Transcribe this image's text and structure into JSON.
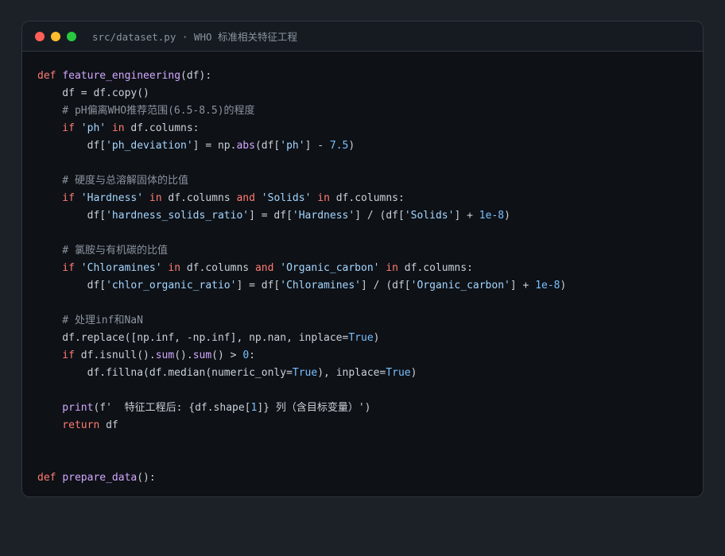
{
  "window": {
    "title": "src/dataset.py · WHO 标准相关特征工程",
    "controls": {
      "close_color": "#ff5f57",
      "minimize_color": "#febc2e",
      "maximize_color": "#28c840"
    }
  },
  "theme": {
    "background": "#0e1116",
    "keyword": "#ff7b72",
    "function": "#d2a8ff",
    "string": "#a5d6ff",
    "number": "#79c0ff",
    "comment": "#8b949e",
    "text": "#c9d1d9"
  },
  "code_lines": [
    [
      [
        "kw",
        "def"
      ],
      [
        "id",
        " "
      ],
      [
        "fn",
        "feature_engineering"
      ],
      [
        "id",
        "(df):"
      ]
    ],
    [
      [
        "id",
        "    df = df.copy()"
      ]
    ],
    [
      [
        "cm",
        "    # pH偏离WHO推荐范围(6.5-8.5)的程度"
      ]
    ],
    [
      [
        "kw",
        "    if "
      ],
      [
        "str",
        "'ph'"
      ],
      [
        "kw",
        " in"
      ],
      [
        "id",
        " df.columns:"
      ]
    ],
    [
      [
        "id",
        "        df["
      ],
      [
        "str",
        "'ph_deviation'"
      ],
      [
        "id",
        "] = np."
      ],
      [
        "fn",
        "abs"
      ],
      [
        "id",
        "(df["
      ],
      [
        "str",
        "'ph'"
      ],
      [
        "id",
        "] - "
      ],
      [
        "num",
        "7.5"
      ],
      [
        "id",
        ")"
      ]
    ],
    [],
    [
      [
        "cm",
        "    # 硬度与总溶解固体的比值"
      ]
    ],
    [
      [
        "kw",
        "    if "
      ],
      [
        "str",
        "'Hardness'"
      ],
      [
        "kw",
        " in"
      ],
      [
        "id",
        " df.columns "
      ],
      [
        "kw",
        "and"
      ],
      [
        "id",
        " "
      ],
      [
        "str",
        "'Solids'"
      ],
      [
        "kw",
        " in"
      ],
      [
        "id",
        " df.columns:"
      ]
    ],
    [
      [
        "id",
        "        df["
      ],
      [
        "str",
        "'hardness_solids_ratio'"
      ],
      [
        "id",
        "] = df["
      ],
      [
        "str",
        "'Hardness'"
      ],
      [
        "id",
        "] / (df["
      ],
      [
        "str",
        "'Solids'"
      ],
      [
        "id",
        "] + "
      ],
      [
        "num",
        "1e-8"
      ],
      [
        "id",
        ")"
      ]
    ],
    [],
    [
      [
        "cm",
        "    # 氯胺与有机碳的比值"
      ]
    ],
    [
      [
        "kw",
        "    if "
      ],
      [
        "str",
        "'Chloramines'"
      ],
      [
        "kw",
        " in"
      ],
      [
        "id",
        " df.columns "
      ],
      [
        "kw",
        "and"
      ],
      [
        "id",
        " "
      ],
      [
        "str",
        "'Organic_carbon'"
      ],
      [
        "kw",
        " in"
      ],
      [
        "id",
        " df.columns:"
      ]
    ],
    [
      [
        "id",
        "        df["
      ],
      [
        "str",
        "'chlor_organic_ratio'"
      ],
      [
        "id",
        "] = df["
      ],
      [
        "str",
        "'Chloramines'"
      ],
      [
        "id",
        "] / (df["
      ],
      [
        "str",
        "'Organic_carbon'"
      ],
      [
        "id",
        "] + "
      ],
      [
        "num",
        "1e-8"
      ],
      [
        "id",
        ")"
      ]
    ],
    [],
    [
      [
        "cm",
        "    # 处理inf和NaN"
      ]
    ],
    [
      [
        "id",
        "    df.replace([np.inf, -np.inf], np.nan, inplace="
      ],
      [
        "bool",
        "True"
      ],
      [
        "id",
        ")"
      ]
    ],
    [
      [
        "kw",
        "    if"
      ],
      [
        "id",
        " df.isnull()."
      ],
      [
        "fn",
        "sum"
      ],
      [
        "id",
        "()."
      ],
      [
        "fn",
        "sum"
      ],
      [
        "id",
        "() > "
      ],
      [
        "num",
        "0"
      ],
      [
        "id",
        ":"
      ]
    ],
    [
      [
        "id",
        "        df.fillna(df.median(numeric_only="
      ],
      [
        "bool",
        "True"
      ],
      [
        "id",
        "), inplace="
      ],
      [
        "bool",
        "True"
      ],
      [
        "id",
        ")"
      ]
    ],
    [],
    [
      [
        "fn",
        "    print"
      ],
      [
        "id",
        "(f'  特征工程后: {df.shape["
      ],
      [
        "num",
        "1"
      ],
      [
        "id",
        "]} 列（含目标变量）')"
      ]
    ],
    [
      [
        "kw",
        "    return"
      ],
      [
        "id",
        " df"
      ]
    ],
    [],
    [],
    [
      [
        "kw",
        "def"
      ],
      [
        "id",
        " "
      ],
      [
        "fn",
        "prepare_data"
      ],
      [
        "id",
        "():"
      ]
    ]
  ]
}
